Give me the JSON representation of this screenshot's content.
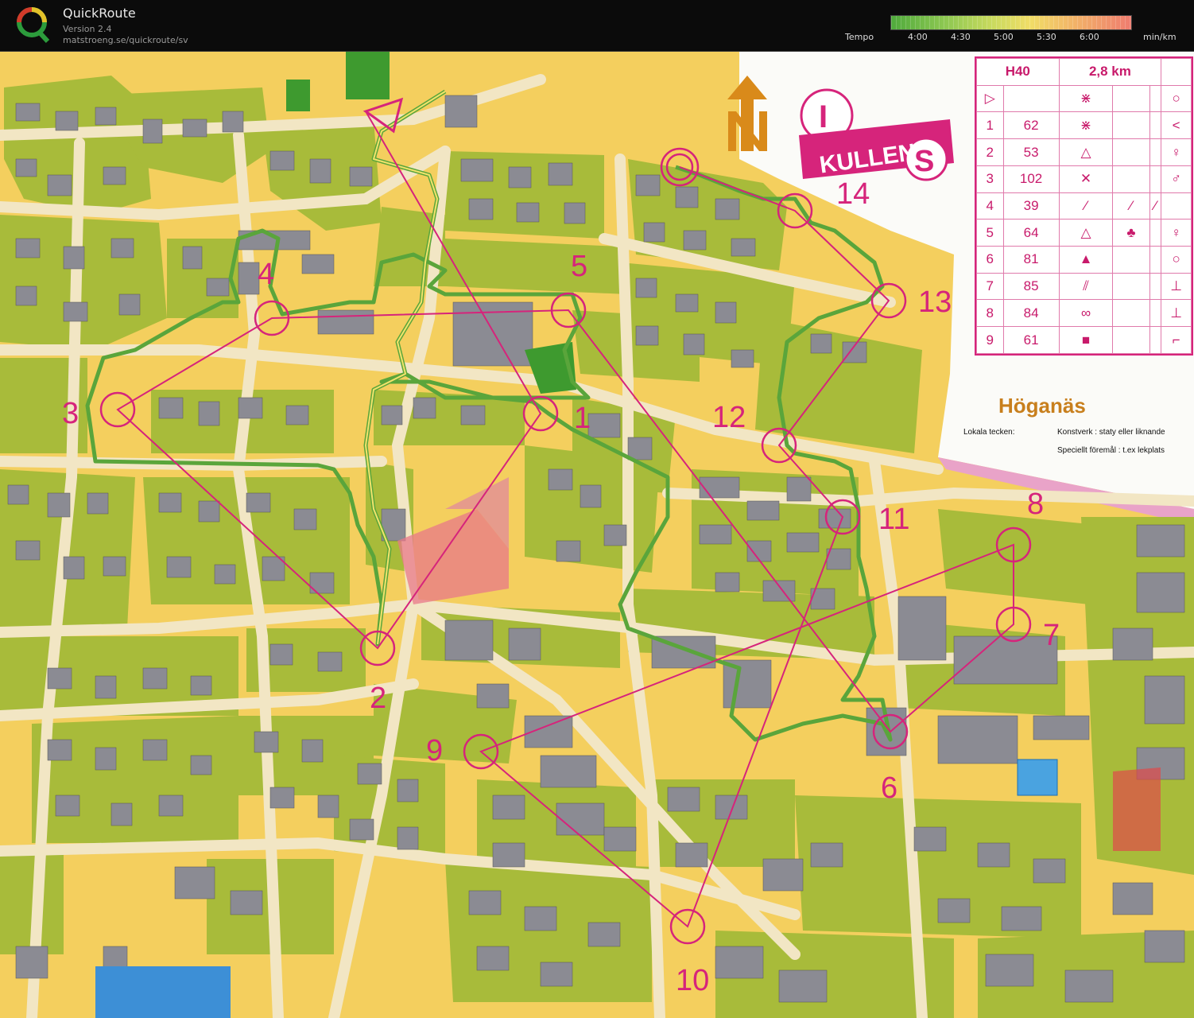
{
  "app": {
    "title": "QuickRoute",
    "version": "Version 2.4",
    "url": "matstroeng.se/quickroute/sv"
  },
  "tempo": {
    "label": "Tempo",
    "ticks": [
      "4:00",
      "4:30",
      "5:00",
      "5:30",
      "6:00"
    ],
    "unit": "min/km",
    "colors": [
      "#4faa3c",
      "#8cc751",
      "#c9da5e",
      "#f1dd67",
      "#f2b468",
      "#ef7c6f"
    ]
  },
  "map": {
    "logo": {
      "top": "I",
      "middle": "KULLEN",
      "bottom": "S"
    },
    "area_name": "Höganäs",
    "legend": {
      "heading": "Lokala tecken:",
      "item1": "Konstverk : staty eller liknande",
      "item2": "Speciellt föremål : t.ex lekplats"
    },
    "controls": [
      "1",
      "2",
      "3",
      "4",
      "5",
      "6",
      "7",
      "8",
      "9",
      "10",
      "11",
      "12",
      "13",
      "14"
    ],
    "description": {
      "class": "H40",
      "length": "2,8 km",
      "rows": [
        {
          "num": "1",
          "code": "62"
        },
        {
          "num": "2",
          "code": "53"
        },
        {
          "num": "3",
          "code": "102"
        },
        {
          "num": "4",
          "code": "39"
        },
        {
          "num": "5",
          "code": "64"
        },
        {
          "num": "6",
          "code": "81"
        },
        {
          "num": "7",
          "code": "85"
        },
        {
          "num": "8",
          "code": "84"
        },
        {
          "num": "9",
          "code": "61"
        }
      ]
    },
    "colors": {
      "course": "#d6247b",
      "green": "#9bb533",
      "open": "#f4cf5e",
      "building": "#8b8b93",
      "road": "#f1e3b8"
    }
  }
}
